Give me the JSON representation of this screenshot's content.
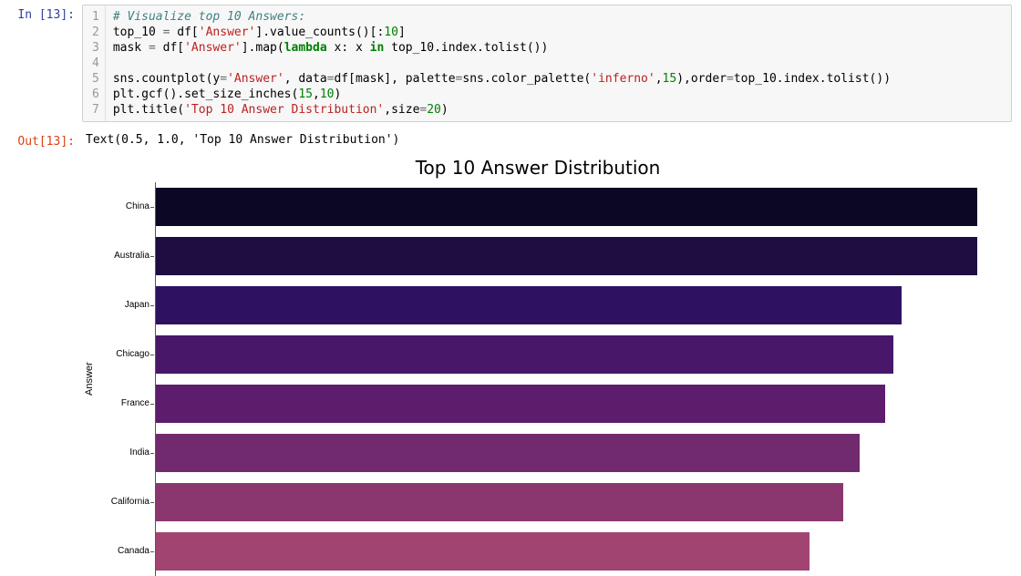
{
  "input_prompt": "In [13]:",
  "output_prompt": "Out[13]:",
  "code_lines": [
    "1",
    "2",
    "3",
    "4",
    "5",
    "6",
    "7"
  ],
  "code": {
    "l1_comment": "# Visualize top 10 Answers:",
    "l2a": "top_10 ",
    "l2op1": "=",
    "l2b": " df[",
    "l2s1": "'Answer'",
    "l2c": "].value_counts()[:",
    "l2n1": "10",
    "l2d": "]",
    "l3a": "mask ",
    "l3op1": "=",
    "l3b": " df[",
    "l3s1": "'Answer'",
    "l3c": "].map(",
    "l3kw": "lambda",
    "l3d": " x: x ",
    "l3in": "in",
    "l3e": " top_10.index.tolist())",
    "l5a": "sns.countplot(y",
    "l5op1": "=",
    "l5s1": "'Answer'",
    "l5b": ", data",
    "l5op2": "=",
    "l5c": "df[mask], palette",
    "l5op3": "=",
    "l5d": "sns.color_palette(",
    "l5s2": "'inferno'",
    "l5e": ",",
    "l5n1": "15",
    "l5f": "),order",
    "l5op4": "=",
    "l5g": "top_10.index.tolist())",
    "l6a": "plt.gcf().set_size_inches(",
    "l6n1": "15",
    "l6b": ",",
    "l6n2": "10",
    "l6c": ")",
    "l7a": "plt.title(",
    "l7s1": "'Top 10 Answer Distribution'",
    "l7b": ",size",
    "l7op1": "=",
    "l7n1": "20",
    "l7c": ")"
  },
  "output_text": "Text(0.5, 1.0, 'Top 10 Answer Distribution')",
  "chart_data": {
    "type": "bar",
    "orientation": "horizontal",
    "title": "Top 10 Answer Distribution",
    "xlabel": "",
    "ylabel": "Answer",
    "categories": [
      "China",
      "Australia",
      "Japan",
      "Chicago",
      "France",
      "India",
      "California",
      "Canada"
    ],
    "values": [
      98,
      98,
      89,
      88,
      87,
      84,
      82,
      78
    ],
    "colors": [
      "#0b0725",
      "#1e0d40",
      "#2f1161",
      "#481769",
      "#5d1d6c",
      "#722a6f",
      "#8a3770",
      "#a14471"
    ],
    "xlim": [
      0,
      100
    ]
  }
}
